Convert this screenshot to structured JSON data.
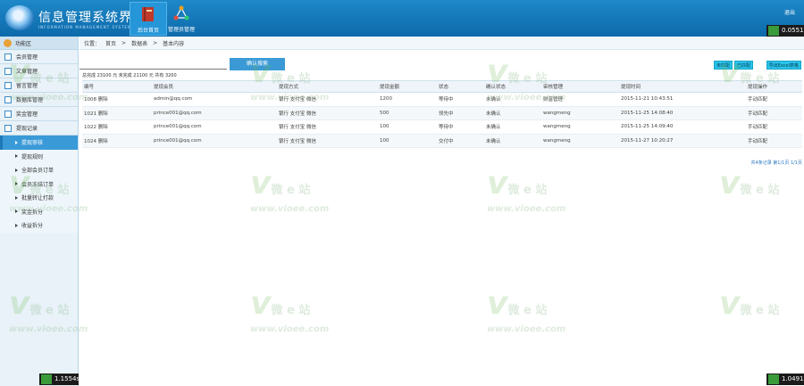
{
  "header": {
    "title": "信息管理系统界面",
    "subtitle": "INFORMATION MANAGEMENT SYSTEM UI",
    "nav": [
      {
        "label": "后台首页"
      },
      {
        "label": "管理员管理"
      }
    ],
    "logout": "退出"
  },
  "timers": {
    "top_right": "0.0551s",
    "bottom_left": "1.1554s",
    "bottom_right": "1.0491s"
  },
  "sidebar": {
    "head": "功能区",
    "items": [
      {
        "label": "会员管理"
      },
      {
        "label": "文章管理"
      },
      {
        "label": "留言管理"
      },
      {
        "label": "数据库管理"
      },
      {
        "label": "奖金管理"
      },
      {
        "label": "提现记录"
      }
    ],
    "sub_items": [
      {
        "label": "提现审核"
      },
      {
        "label": "提现规则"
      },
      {
        "label": "全部会员订单"
      },
      {
        "label": "会员冻结订单"
      },
      {
        "label": "批量转让打款"
      },
      {
        "label": "奖金拆分"
      },
      {
        "label": "收益拆分"
      }
    ]
  },
  "breadcrumb": [
    "位置：",
    "首页",
    "数据表",
    "基本内容"
  ],
  "search": {
    "placeholder": "",
    "button": "确认搜索"
  },
  "tools": [
    "未匹配",
    "已匹配",
    "导出Excel表格"
  ],
  "summary": "总完成 23100 元 未完成 21100 元 共有 3200",
  "table": {
    "headers": [
      "编号",
      "提现会员",
      "提现方式",
      "提现金额",
      "状态",
      "确认状态",
      "审核管理",
      "提现时间",
      "提现操作"
    ],
    "rows": [
      [
        "1008 删除",
        "admin@qq.com",
        "银行 支付宝 微信",
        "1200",
        "等待中",
        "未确认",
        "财富管理",
        "2015-11-21 10:43:51",
        "手动匹配"
      ],
      [
        "1021 删除",
        "prince001@qq.com",
        "银行 支付宝 微信",
        "500",
        "领先中",
        "未确认",
        "wangmeng",
        "2015-11-25 14:08:40",
        "手动匹配"
      ],
      [
        "1022 删除",
        "prince001@qq.com",
        "银行 支付宝 微信",
        "100",
        "等待中",
        "未确认",
        "wangmeng",
        "2015-11-25 14:09:40",
        "手动匹配"
      ],
      [
        "1024 删除",
        "prince001@qq.com",
        "银行 支付宝 微信",
        "100",
        "交付中",
        "未确认",
        "wangmeng",
        "2015-11-27 10:20:27",
        "手动匹配"
      ]
    ]
  },
  "pager": "共4条记录 第1/1页 1/1页",
  "watermark": {
    "mark": "v",
    "chars": "微 e 站",
    "url": "www.vioee.com"
  }
}
